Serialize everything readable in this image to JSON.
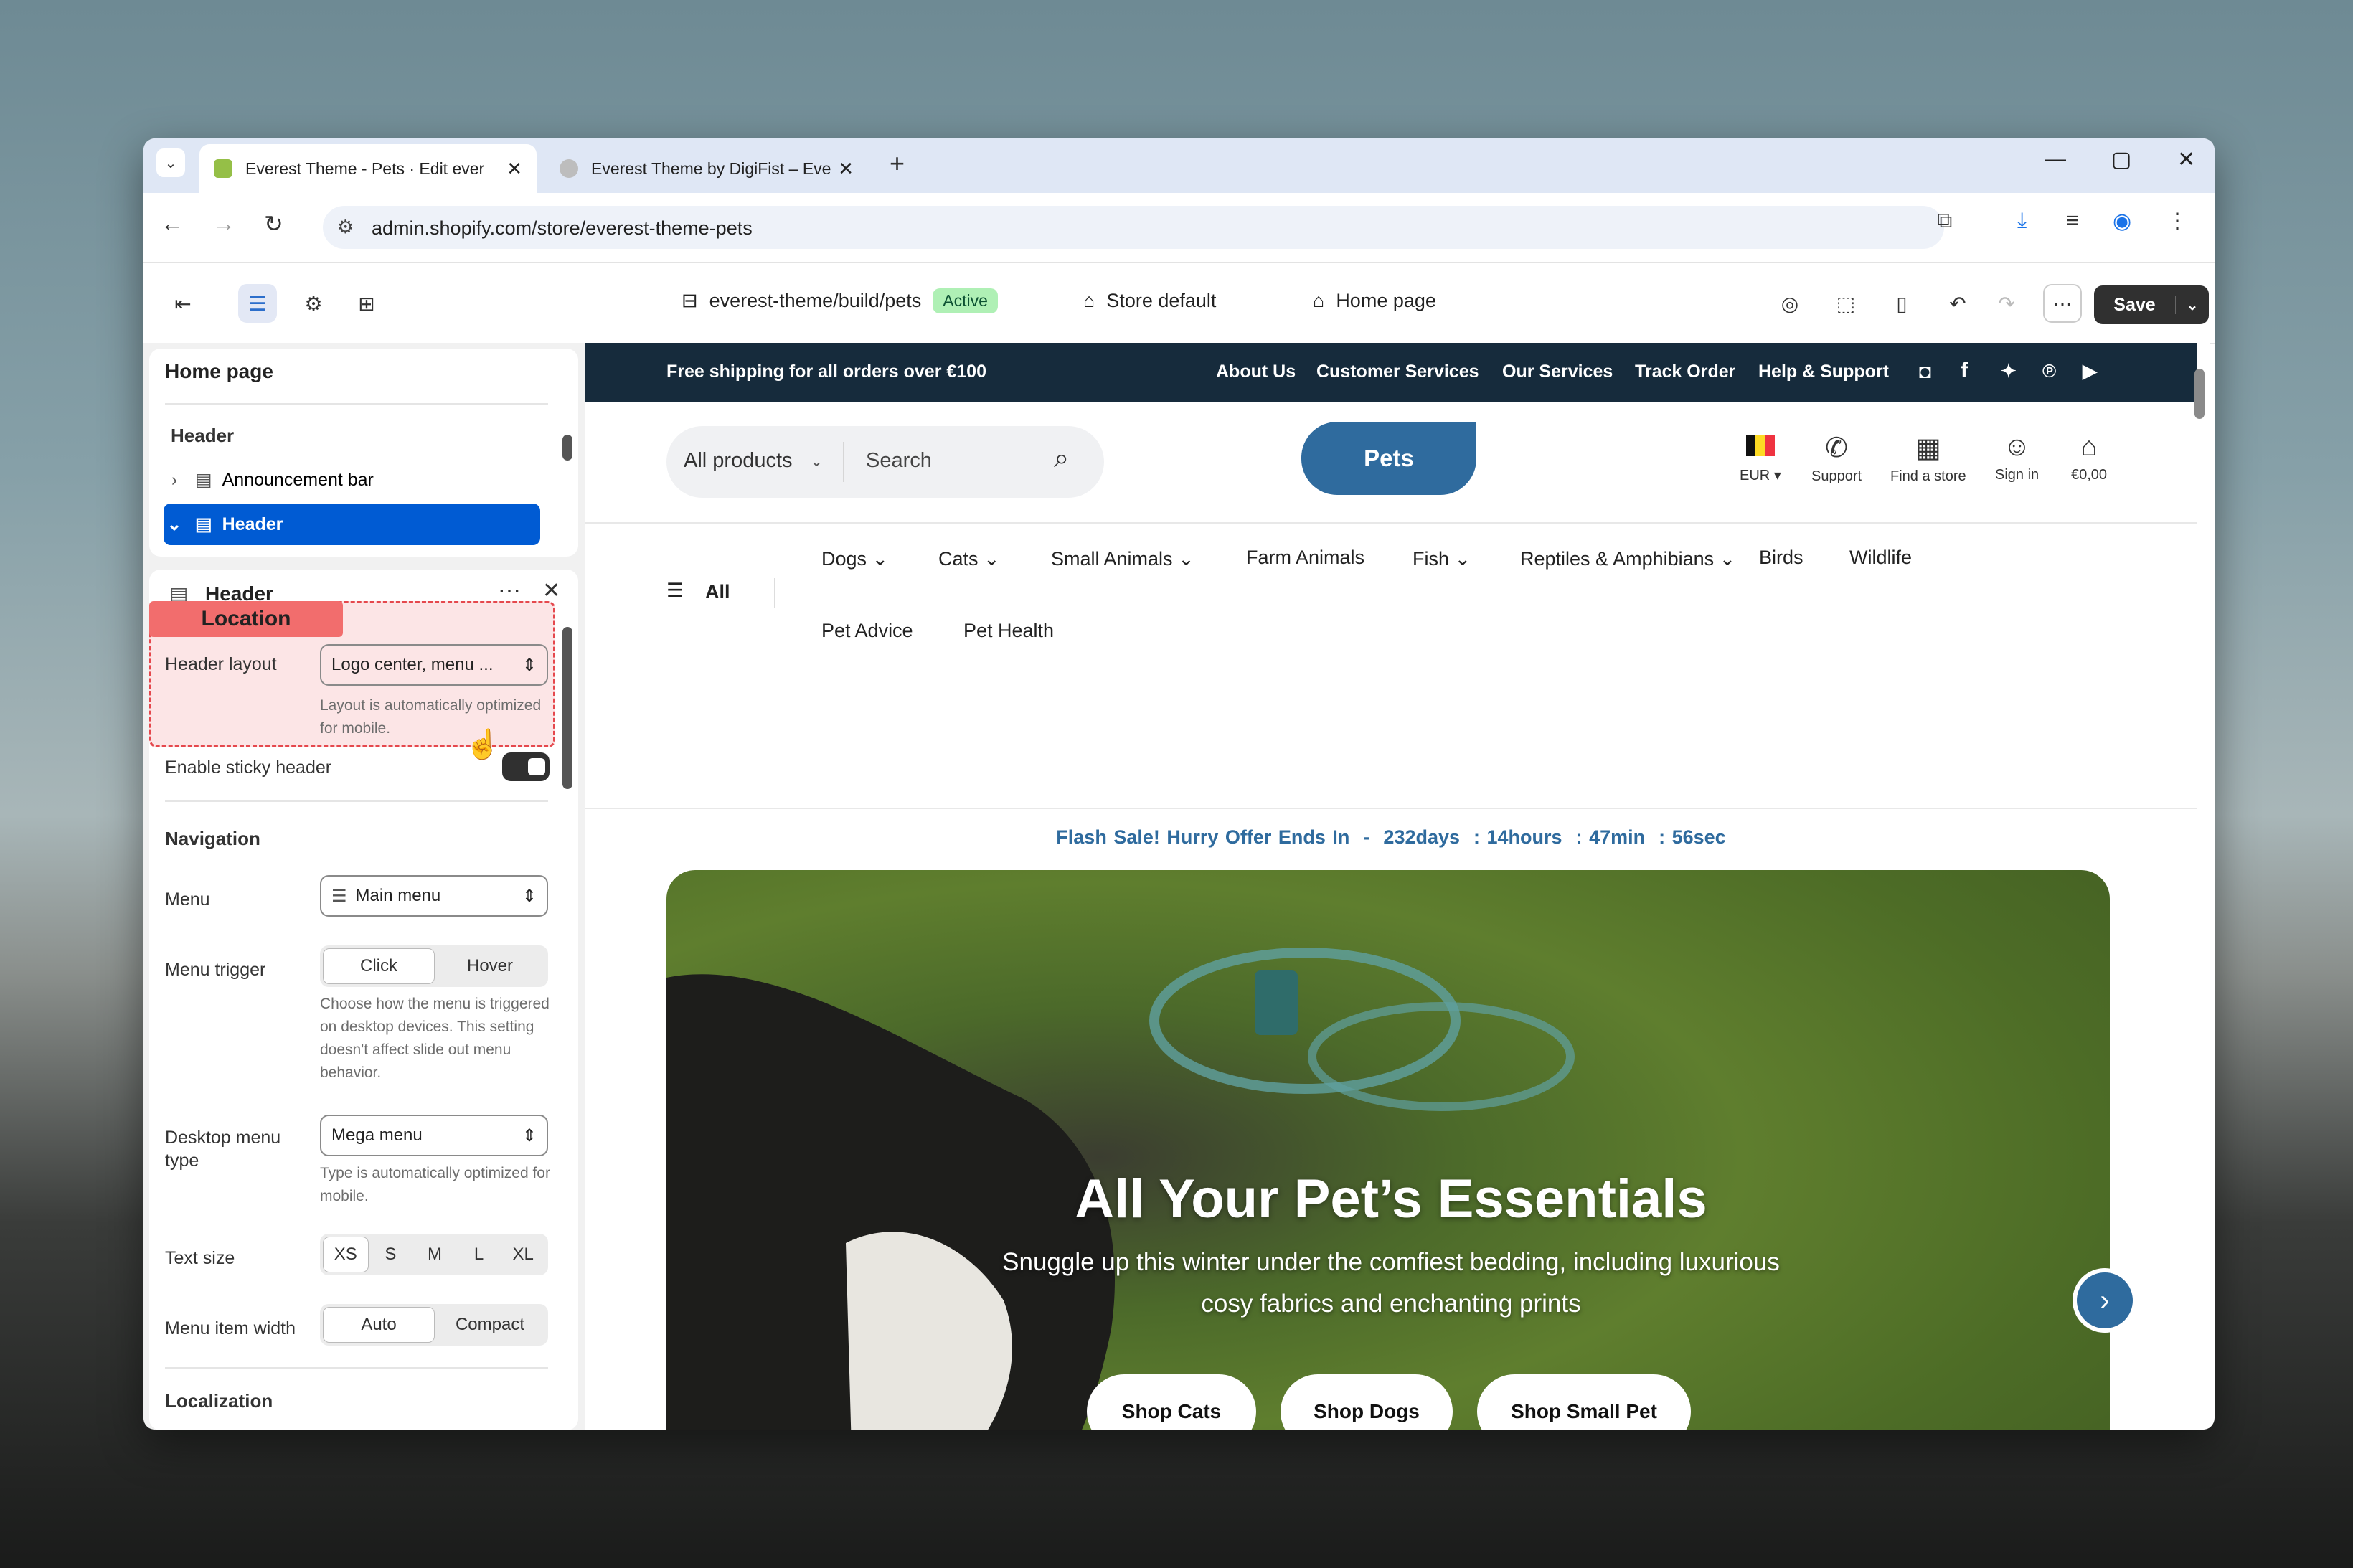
{
  "browser": {
    "tabs": [
      {
        "title": "Everest Theme - Pets · Edit ever",
        "active": true,
        "favicon_color": "#95bf47"
      },
      {
        "title": "Everest Theme by DigiFist – Eve",
        "active": false,
        "favicon_color": "#888888"
      }
    ],
    "url": "admin.shopify.com/store/everest-theme-pets"
  },
  "editor": {
    "theme_name": "everest-theme/build/pets",
    "theme_status": "Active",
    "store_context": "Store default",
    "page_context": "Home page",
    "save_label": "Save"
  },
  "sidebar": {
    "page_title": "Home page",
    "group_header": "Header",
    "tree": [
      {
        "label": "Announcement bar",
        "selected": false
      },
      {
        "label": "Header",
        "selected": true
      }
    ],
    "settings_title": "Header",
    "callout": "Location",
    "header_layout": {
      "label": "Header layout",
      "value": "Logo center, menu ...",
      "help": "Layout is automatically optimized for mobile."
    },
    "sticky": {
      "label": "Enable sticky header",
      "on": true
    },
    "navigation_heading": "Navigation",
    "menu": {
      "label": "Menu",
      "value": "Main menu"
    },
    "menu_trigger": {
      "label": "Menu trigger",
      "options": [
        "Click",
        "Hover"
      ],
      "selected": "Click",
      "help": "Choose how the menu is triggered on desktop devices. This setting doesn't affect slide out menu behavior."
    },
    "desktop_menu_type": {
      "label_1": "Desktop menu",
      "label_2": "type",
      "value": "Mega menu",
      "help": "Type is automatically optimized for mobile."
    },
    "text_size": {
      "label": "Text size",
      "options": [
        "XS",
        "S",
        "M",
        "L",
        "XL"
      ],
      "selected": "XS"
    },
    "menu_item_width": {
      "label": "Menu item width",
      "options": [
        "Auto",
        "Compact"
      ],
      "selected": "Auto"
    },
    "localization_heading": "Localization"
  },
  "store": {
    "announcement": "Free shipping for all orders over €100",
    "top_links": [
      "About Us",
      "Customer Services",
      "Our Services",
      "Track Order",
      "Help & Support"
    ],
    "search_category": "All products",
    "search_placeholder": "Search",
    "logo": "Pets",
    "currency": "EUR",
    "header_icons": [
      "Support",
      "Find a store",
      "Sign in",
      "€0,00"
    ],
    "all_label": "All",
    "menu_row1": [
      "Dogs",
      "Cats",
      "Small Animals",
      "Farm Animals",
      "Fish",
      "Reptiles & Amphibians",
      "Birds",
      "Wildlife"
    ],
    "menu_row2": [
      "Pet Advice",
      "Pet Health"
    ],
    "flash": {
      "text": "Flash Sale! Hurry Offer Ends In",
      "sep": "-",
      "days": "232days",
      "hours": "14hours",
      "mins": "47min",
      "secs": "56sec"
    },
    "hero": {
      "title": "All Your Pet’s Essentials",
      "subtitle_1": "Snuggle up this winter under the comfiest bedding, including luxurious",
      "subtitle_2": "cosy fabrics and enchanting prints",
      "buttons": [
        "Shop Cats",
        "Shop Dogs",
        "Shop Small Pet"
      ]
    }
  }
}
